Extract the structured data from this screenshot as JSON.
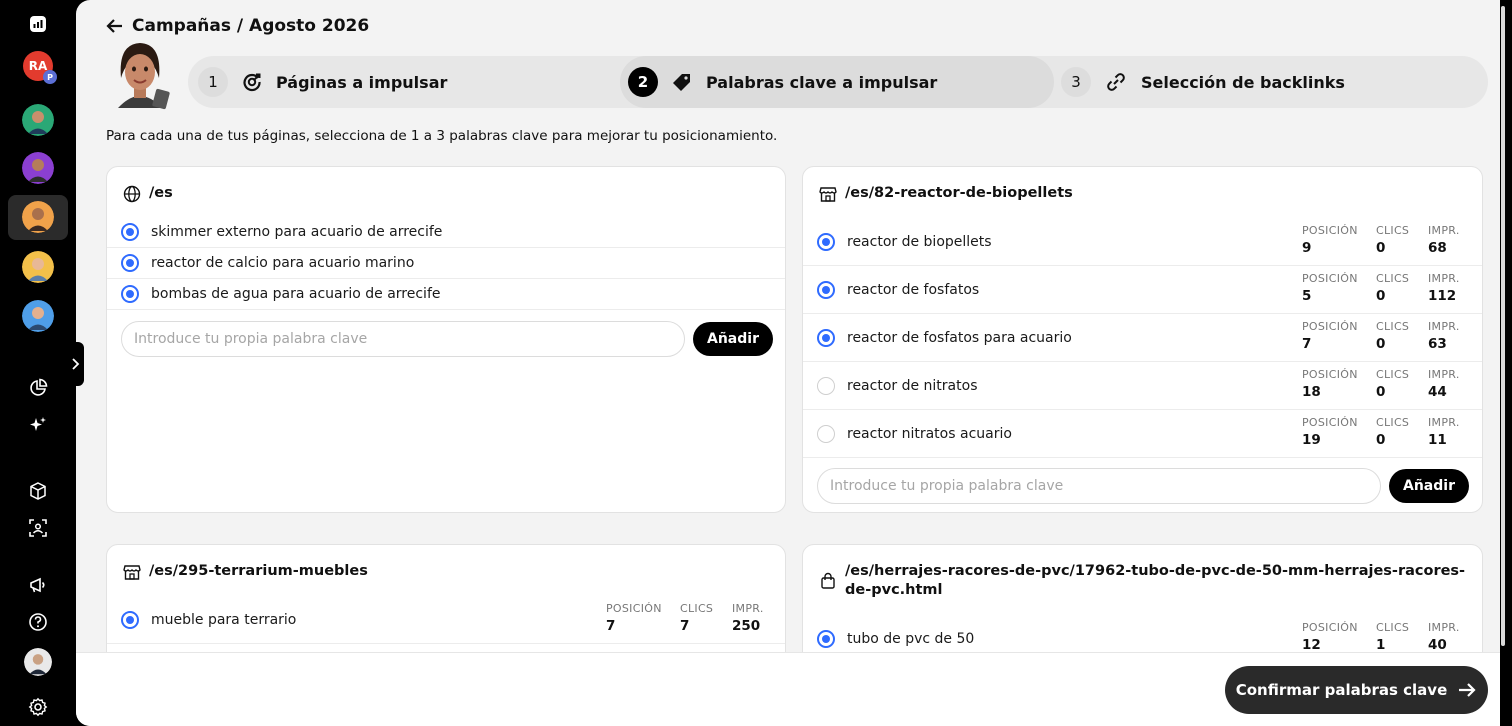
{
  "breadcrumb": {
    "text": "Campañas / Agosto 2026"
  },
  "steps": [
    {
      "num": "1",
      "label": "Páginas a impulsar"
    },
    {
      "num": "2",
      "label": "Palabras clave a impulsar"
    },
    {
      "num": "3",
      "label": "Selección de backlinks"
    }
  ],
  "intro": "Para cada una de tus páginas, selecciona de 1 a 3 palabras clave para mejorar tu posicionamiento.",
  "sidebar": {
    "avatar_initials": "RA",
    "avatar_badge": "P"
  },
  "metric_labels": {
    "pos": "POSICIÓN",
    "clics": "CLICS",
    "impr": "IMPR."
  },
  "input_placeholder": "Introduce tu propia palabra clave",
  "add_label": "Añadir",
  "cards": [
    {
      "title": "/es",
      "keywords": [
        {
          "text": "skimmer externo para acuario de arrecife",
          "selected": true
        },
        {
          "text": "reactor de calcio para acuario marino",
          "selected": true
        },
        {
          "text": "bombas de agua para acuario de arrecife",
          "selected": true
        }
      ]
    },
    {
      "title": "/es/82-reactor-de-biopellets",
      "keywords": [
        {
          "text": "reactor de biopellets",
          "selected": true,
          "pos": "9",
          "clics": "0",
          "impr": "68"
        },
        {
          "text": "reactor de fosfatos",
          "selected": true,
          "pos": "5",
          "clics": "0",
          "impr": "112"
        },
        {
          "text": "reactor de fosfatos para acuario",
          "selected": true,
          "pos": "7",
          "clics": "0",
          "impr": "63"
        },
        {
          "text": "reactor de nitratos",
          "selected": false,
          "pos": "18",
          "clics": "0",
          "impr": "44"
        },
        {
          "text": "reactor nitratos acuario",
          "selected": false,
          "pos": "19",
          "clics": "0",
          "impr": "11"
        }
      ]
    },
    {
      "title": "/es/295-terrarium-muebles",
      "keywords": [
        {
          "text": "mueble para terrario",
          "selected": true,
          "pos": "7",
          "clics": "7",
          "impr": "250"
        }
      ]
    },
    {
      "title": "/es/herrajes-racores-de-pvc/17962-tubo-de-pvc-de-50-mm-herrajes-racores-de-pvc.html",
      "keywords": [
        {
          "text": "tubo de pvc de 50",
          "selected": true,
          "pos": "12",
          "clics": "1",
          "impr": "40"
        }
      ]
    }
  ],
  "confirm_label": "Confirmar palabras clave",
  "colors": {
    "accent": "#2f6bff",
    "primary_btn": "#000000",
    "confirm_btn": "#2a2a2a"
  }
}
